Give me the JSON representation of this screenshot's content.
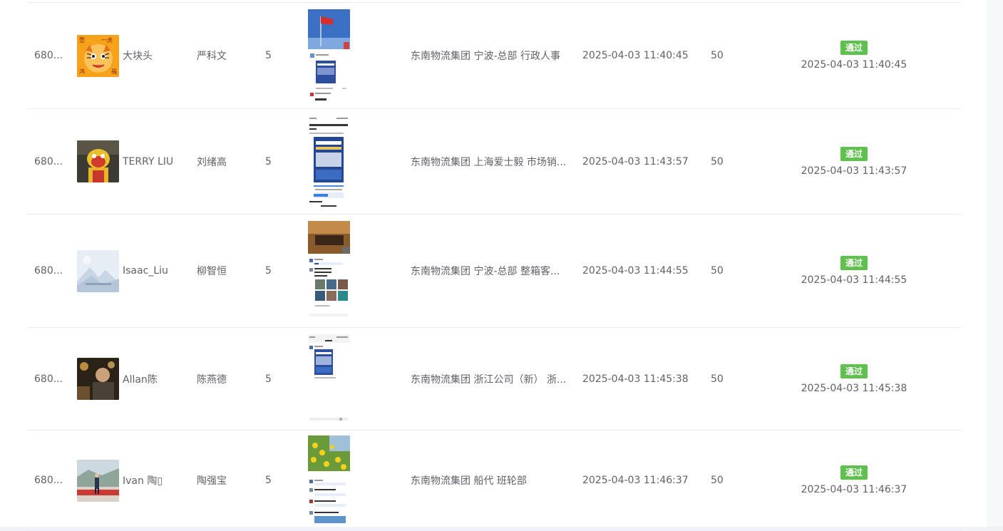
{
  "rows": [
    {
      "id": "680...",
      "avatar": "tiger-cartoon-avatar",
      "avatar_glyphs": [
        "壹",
        "一虎",
        "鸿",
        "福"
      ],
      "nickname": "大块头",
      "name": "严科文",
      "count": "5",
      "screenshot": "flag-moments-screenshot",
      "department": "东南物流集团 宁波-总部 行政人事",
      "submit_time": "2025-04-03 11:40:45",
      "score": "50",
      "status": "通过",
      "review_time": "2025-04-03 11:40:45"
    },
    {
      "id": "680...",
      "avatar": "lion-dance-avatar",
      "nickname": "TERRY LIU",
      "name": "刘绪高",
      "count": "5",
      "screenshot": "article-moments-screenshot",
      "department": "东南物流集团 上海爱士毅 市场销...",
      "submit_time": "2025-04-03 11:43:57",
      "score": "50",
      "status": "通过",
      "review_time": "2025-04-03 11:43:57"
    },
    {
      "id": "680...",
      "avatar": "landscape-placeholder-avatar",
      "nickname": "Isaac_Liu",
      "name": "柳智恒",
      "count": "5",
      "screenshot": "photo-grid-moments-screenshot",
      "department": "东南物流集团 宁波-总部 整箱客...",
      "submit_time": "2025-04-03 11:44:55",
      "score": "50",
      "status": "通过",
      "review_time": "2025-04-03 11:44:55"
    },
    {
      "id": "680...",
      "avatar": "night-portrait-avatar",
      "nickname": "Allan陈",
      "name": "陈燕德",
      "count": "5",
      "screenshot": "share-post-screenshot",
      "department": "东南物流集团 浙江公司（新） 浙...",
      "submit_time": "2025-04-03 11:45:38",
      "score": "50",
      "status": "通过",
      "review_time": "2025-04-03 11:45:38"
    },
    {
      "id": "680...",
      "avatar": "outdoor-person-avatar",
      "nickname": "Ivan 陶▯",
      "name": "陶强宝",
      "count": "5",
      "screenshot": "flowers-moments-screenshot",
      "department": "东南物流集团 船代 班轮部",
      "submit_time": "2025-04-03 11:46:37",
      "score": "50",
      "status": "通过",
      "review_time": "2025-04-03 11:46:37"
    }
  ],
  "colors": {
    "badge": "#5ec04d",
    "text": "#606266",
    "border": "#ebeef5"
  }
}
